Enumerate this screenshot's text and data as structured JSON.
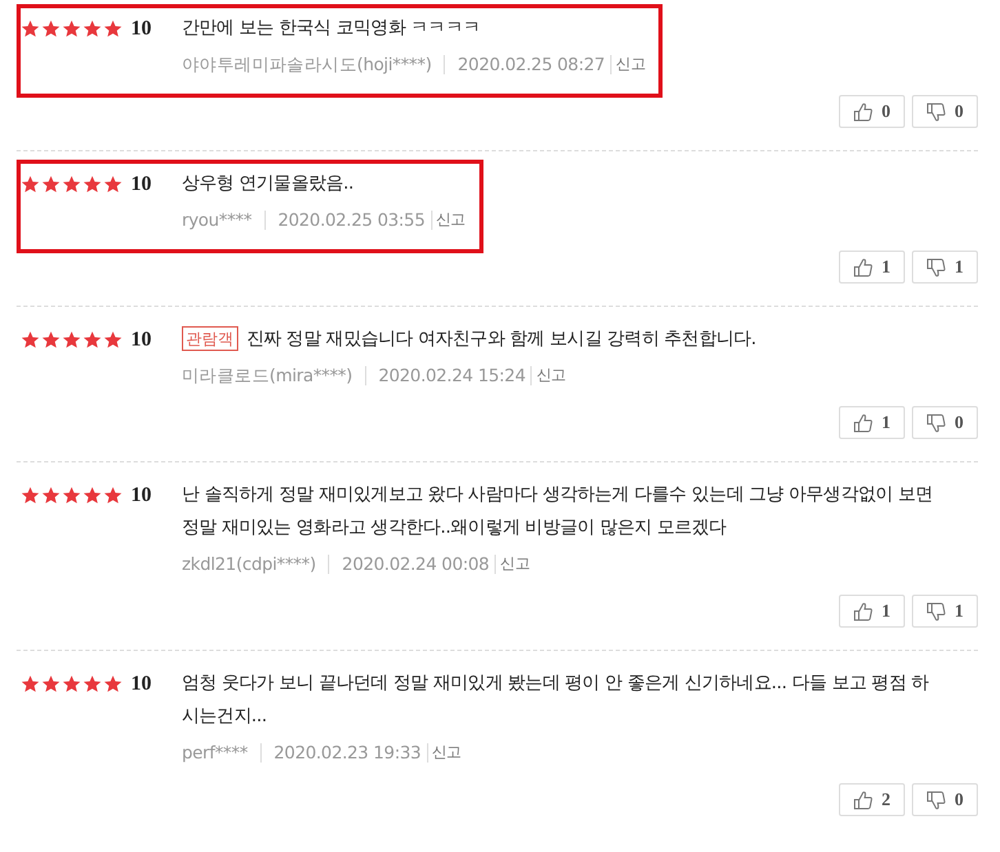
{
  "reviews": [
    {
      "stars": 5,
      "score": "10",
      "highlighted": true,
      "text": "간만에 보는 한국식 코믹영화 ㅋㅋㅋㅋ",
      "author": "야야투레미파솔라시도(hoji****)",
      "date": "2020.02.25 08:27",
      "report": "신고",
      "likes": "0",
      "dislikes": "0"
    },
    {
      "stars": 5,
      "score": "10",
      "highlighted": true,
      "text": "상우형 연기물올랐음..",
      "author": "ryou****",
      "date": "2020.02.25 03:55",
      "report": "신고",
      "likes": "1",
      "dislikes": "1"
    },
    {
      "stars": 5,
      "score": "10",
      "highlighted": false,
      "badge": "관람객",
      "text": "진짜 정말 재밌습니다 여자친구와 함께 보시길 강력히 추천합니다.",
      "author": "미라클로드(mira****)",
      "date": "2020.02.24 15:24",
      "report": "신고",
      "likes": "1",
      "dislikes": "0"
    },
    {
      "stars": 5,
      "score": "10",
      "highlighted": false,
      "text": "난 솔직하게 정말 재미있게보고 왔다 사람마다 생각하는게 다를수 있는데 그냥 아무생각없이 보면 정말 재미있는 영화라고 생각한다..왜이렇게 비방글이 많은지 모르겠다",
      "author": "zkdl21(cdpi****)",
      "date": "2020.02.24 00:08",
      "report": "신고",
      "likes": "1",
      "dislikes": "1"
    },
    {
      "stars": 5,
      "score": "10",
      "highlighted": false,
      "text": "엄청 웃다가 보니 끝나던데 정말 재미있게 봤는데 평이 안 좋은게 신기하네요... 다들 보고 평점 하시는건지...",
      "author": "perf****",
      "date": "2020.02.23 19:33",
      "report": "신고",
      "likes": "2",
      "dislikes": "0"
    }
  ]
}
